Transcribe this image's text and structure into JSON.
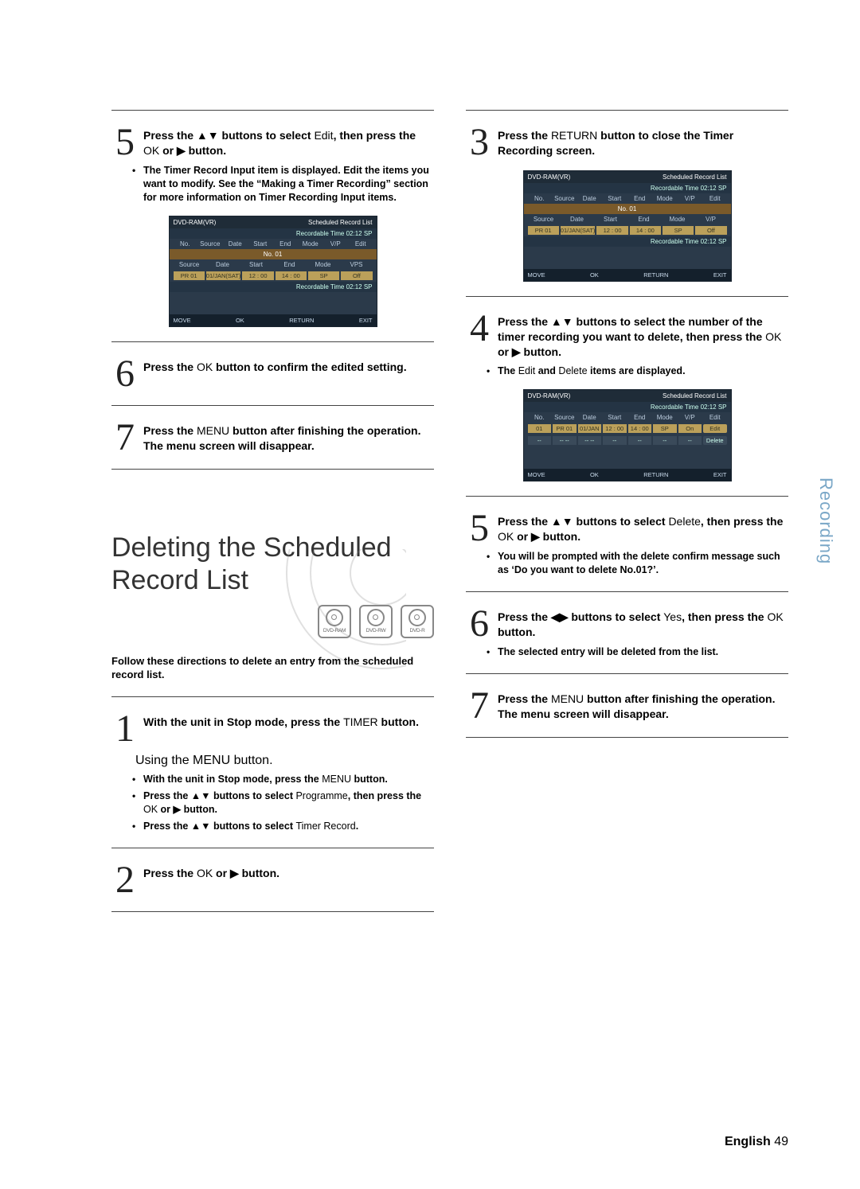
{
  "sideTab": "Recording",
  "pageFoot": {
    "label": "English",
    "num": "49"
  },
  "discs": [
    "DVD-RAM",
    "DVD-RW",
    "DVD-R"
  ],
  "left": {
    "step5": {
      "num": "5",
      "text_a": "Press the ▲▼ buttons to select ",
      "text_edit": "Edit",
      "text_b": ", then press the ",
      "text_ok": "OK",
      "text_c": " or ▶ button.",
      "bullet": "The Timer Record Input item is displayed. Edit the items you want to modify. See the “Making a Timer Recording” section for more information on Timer Recording Input items."
    },
    "step6": {
      "num": "6",
      "text_a": "Press the ",
      "text_ok": "OK",
      "text_b": " button to confirm the edited setting."
    },
    "step7": {
      "num": "7",
      "text_a": "Press the ",
      "text_menu": "MENU",
      "text_b": " button after finishing the operation. The menu screen will disappear."
    },
    "sectionTitle": "Deleting the Scheduled Record List",
    "intro": "Follow these directions to delete an entry from the scheduled record list.",
    "step1": {
      "num": "1",
      "text_a": "With the unit in Stop mode, press the ",
      "text_timer": "TIMER",
      "text_b": " button."
    },
    "usingMenu": "Using the MENU button.",
    "sub1": {
      "a": "With the unit in Stop mode, press the ",
      "menu": "MENU",
      "b": " button."
    },
    "sub2": {
      "a": "Press the ▲▼ buttons to select ",
      "prog": "Programme",
      "b": ", then press the ",
      "ok": "OK",
      "c": " or ▶ button."
    },
    "sub3": {
      "a": "Press the ▲▼ buttons to select ",
      "tr": "Timer Record",
      "b": "."
    },
    "step2": {
      "num": "2",
      "text_a": "Press the ",
      "text_ok": "OK",
      "text_b": " or ▶ button."
    }
  },
  "right": {
    "step3": {
      "num": "3",
      "text_a": "Press the ",
      "text_ret": "RETURN",
      "text_b": " button to close the Timer Recording screen."
    },
    "step4": {
      "num": "4",
      "text_a": "Press the ▲▼ buttons to select the number of the timer recording you want to delete, then press the ",
      "text_ok": "OK",
      "text_b": " or ▶ button.",
      "bullet_a": "The ",
      "bullet_edit": "Edit",
      "bullet_b": " and ",
      "bullet_del": "Delete",
      "bullet_c": " items are displayed."
    },
    "step5": {
      "num": "5",
      "text_a": "Press the ▲▼ buttons to select ",
      "text_del": "Delete",
      "text_b": ", then press the ",
      "text_ok": "OK",
      "text_c": " or ▶ button.",
      "bullet": "You will be prompted with the delete confirm message such as ‘Do you want to delete No.01?’."
    },
    "step6": {
      "num": "6",
      "text_a": "Press the ◀▶ buttons to select ",
      "text_yes": "Yes",
      "text_b": ", then press the ",
      "text_ok": "OK",
      "text_c": " button.",
      "bullet": "The selected entry will be deleted from the list."
    },
    "step7": {
      "num": "7",
      "text_a": "Press the ",
      "text_menu": "MENU",
      "text_b": " button after finishing the operation. The menu screen will disappear."
    }
  },
  "osd1": {
    "device": "DVD-RAM(VR)",
    "title": "Scheduled Record List",
    "rectime": "Recordable Time 02:12 SP",
    "hdr": [
      "No.",
      "Source",
      "Date",
      "Start",
      "End",
      "Mode",
      "V/P",
      "Edit"
    ],
    "highlight": "No. 01",
    "fieldHdr": [
      "Source",
      "Date",
      "Start",
      "End",
      "Mode",
      "VPS"
    ],
    "row": [
      "PR 01",
      "01/JAN(SAT)",
      "12 : 00",
      "14 : 00",
      "SP",
      "Off"
    ],
    "rectime2": "Recordable Time 02:12 SP",
    "foot": [
      "MOVE",
      "OK",
      "RETURN",
      "EXIT"
    ]
  },
  "osd2": {
    "device": "DVD-RAM(VR)",
    "title": "Scheduled Record List",
    "rectime": "Recordable Time 02:12 SP",
    "hdr": [
      "No.",
      "Source",
      "Date",
      "Start",
      "End",
      "Mode",
      "V/P",
      "Edit"
    ],
    "highlight": "No. 01",
    "fieldHdr": [
      "Source",
      "Date",
      "Start",
      "End",
      "Mode",
      "V/P"
    ],
    "row": [
      "PR 01",
      "01/JAN(SAT)",
      "12 : 00",
      "14 : 00",
      "SP",
      "Off"
    ],
    "rectime2": "Recordable Time 02:12 SP",
    "foot": [
      "MOVE",
      "OK",
      "RETURN",
      "EXIT"
    ]
  },
  "osd3": {
    "device": "DVD-RAM(VR)",
    "title": "Scheduled Record List",
    "rectime": "Recordable Time 02:12 SP",
    "hdr": [
      "No.",
      "Source",
      "Date",
      "Start",
      "End",
      "Mode",
      "V/P",
      "Edit"
    ],
    "row": [
      "01",
      "PR 01",
      "01/JAN",
      "12 : 00",
      "14 : 00",
      "SP",
      "On"
    ],
    "chipEdit": "Edit",
    "chipDelete": "Delete",
    "foot": [
      "MOVE",
      "OK",
      "RETURN",
      "EXIT"
    ]
  }
}
